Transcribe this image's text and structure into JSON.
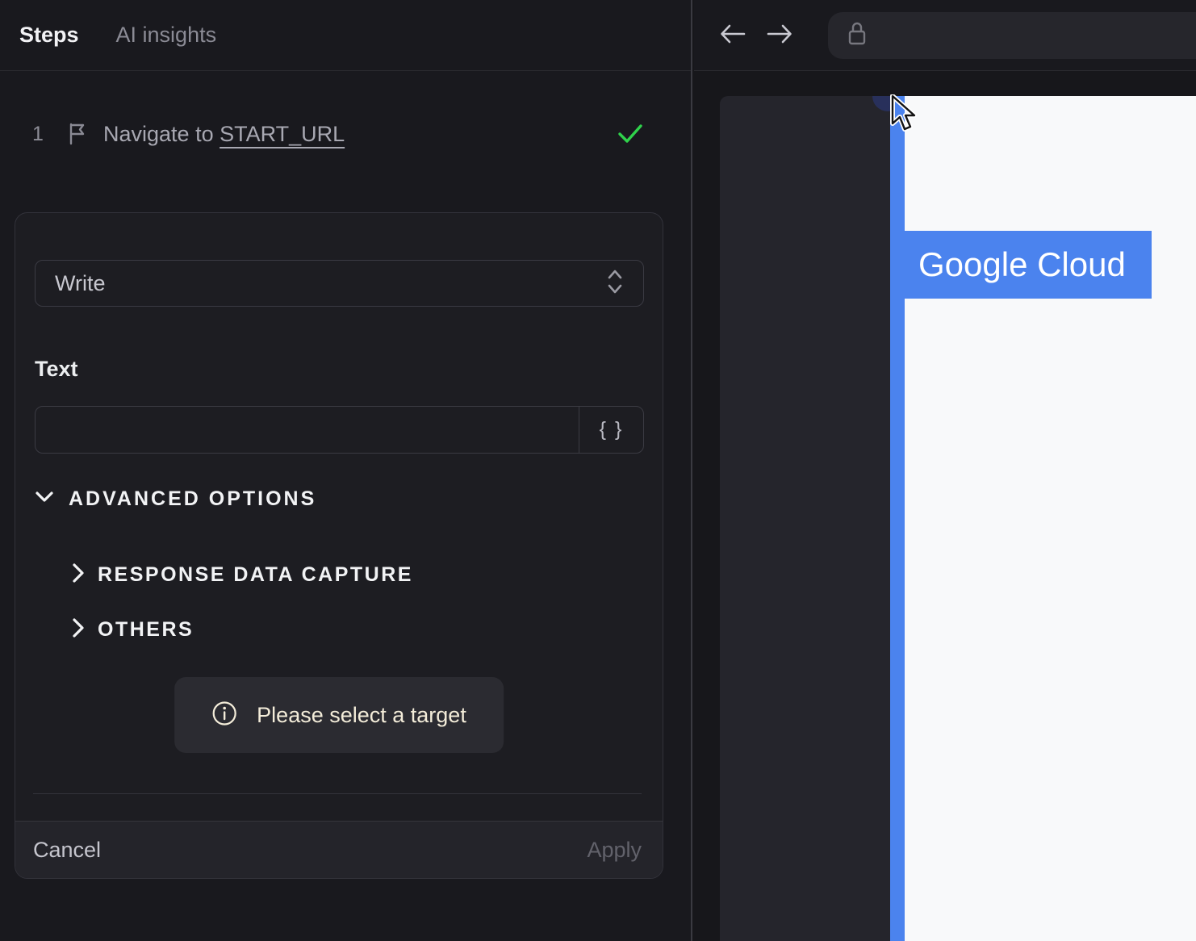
{
  "tabs": {
    "steps": "Steps",
    "ai_insights": "AI insights"
  },
  "step": {
    "number": "1",
    "text": "Navigate to ",
    "link": "START_URL",
    "status": "success"
  },
  "form": {
    "action_value": "Write",
    "text_label": "Text",
    "text_value": "",
    "variable_button": "{ }",
    "advanced_label": "ADVANCED OPTIONS",
    "advanced_expanded": true,
    "sections": [
      "RESPONSE DATA CAPTURE",
      "OTHERS"
    ],
    "notice": "Please select a target",
    "cancel": "Cancel",
    "apply": "Apply",
    "apply_enabled": false
  },
  "browser": {
    "address_value": "",
    "highlight_label": "Google Cloud"
  },
  "icons": [
    "flag-icon",
    "check-icon",
    "chevron-up-down-icon",
    "braces-icon",
    "chevron-down-icon",
    "chevron-right-icon",
    "info-icon",
    "arrow-left-icon",
    "arrow-right-icon",
    "lock-icon",
    "cursor-pointer-icon"
  ],
  "colors": {
    "accent_blue": "#4b83ee",
    "success_green": "#2fd24b",
    "notice_text": "#f3ecd9",
    "panel_bg": "#19191e",
    "card_bg": "#1d1d22",
    "page_bg": "#f8f9fa"
  }
}
